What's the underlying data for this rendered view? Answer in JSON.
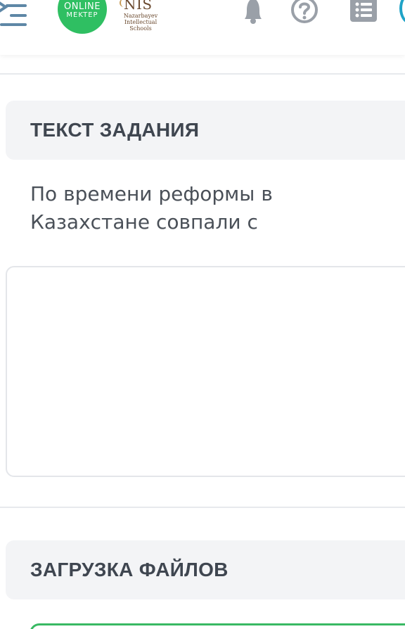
{
  "header": {
    "logo": {
      "line1": "ONLINE",
      "line2": "MEKTEP",
      "color": "#2fbf62"
    },
    "nis": {
      "mark": "NIS",
      "sub": "Nazarbayev Intellectual Schools"
    },
    "icons": [
      "menu-icon",
      "bell-icon",
      "help-icon",
      "list-icon",
      "avatar"
    ]
  },
  "task_section": {
    "title": "ТЕКСТ ЗАДАНИЯ",
    "text": "По времени реформы в Казахстане совпали с"
  },
  "answer": {
    "value": ""
  },
  "upload_section": {
    "title": "ЗАГРУЗКА ФАЙЛОВ"
  },
  "colors": {
    "accent_green": "#39b963",
    "icon_grey": "#9aa0a8",
    "avatar_blue": "#20a3c7",
    "section_bg": "#f3f4f6"
  }
}
